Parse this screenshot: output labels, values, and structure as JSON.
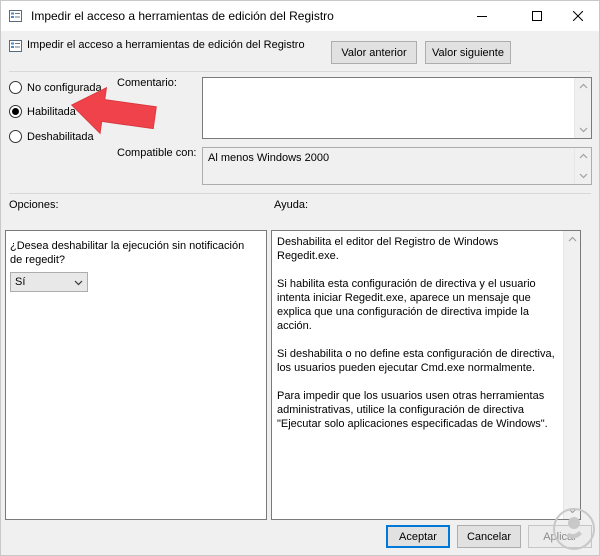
{
  "window": {
    "title": "Impedir el acceso a herramientas de edición del Registro"
  },
  "policy": {
    "name": "Impedir el acceso a herramientas de edición del Registro"
  },
  "nav": {
    "prev_label": "Valor anterior",
    "next_label": "Valor siguiente"
  },
  "state": {
    "options": [
      {
        "label": "No configurada",
        "checked": false
      },
      {
        "label": "Habilitada",
        "checked": true
      },
      {
        "label": "Deshabilitada",
        "checked": false
      }
    ]
  },
  "comment": {
    "label": "Comentario:",
    "value": ""
  },
  "compat": {
    "label": "Compatible con:",
    "value": "Al menos Windows 2000"
  },
  "options_section": {
    "label": "Opciones:",
    "question": "¿Desea deshabilitar la ejecución sin notificación de regedit?",
    "selected": "Sí"
  },
  "help_section": {
    "label": "Ayuda:",
    "paragraphs": [
      "Deshabilita el editor del Registro de Windows Regedit.exe.",
      "Si habilita esta configuración de directiva y el usuario intenta iniciar Regedit.exe, aparece un mensaje que explica que una configuración de directiva impide la acción.",
      "Si deshabilita o no define esta configuración de directiva, los usuarios pueden ejecutar Cmd.exe normalmente.",
      "Para impedir que los usuarios usen otras herramientas administrativas, utilice la configuración de directiva \"Ejecutar solo aplicaciones especificadas de Windows\"."
    ]
  },
  "footer": {
    "accept_label": "Aceptar",
    "cancel_label": "Cancelar",
    "apply_label": "Aplicar"
  },
  "colors": {
    "accent": "#0078d7",
    "annotation_arrow": "#f0424a"
  }
}
